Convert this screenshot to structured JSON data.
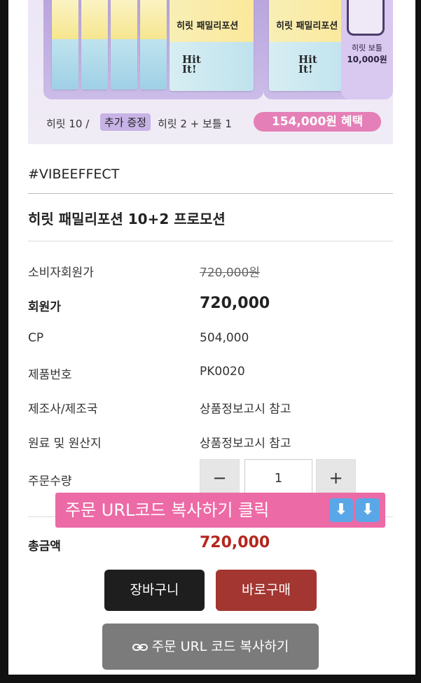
{
  "banner": {
    "product_name": "히릿 패밀리포션",
    "logo_text": "Hit It!",
    "bottle_title": "히릿 보틀",
    "bottle_price": "10,000원",
    "line_text_1": "히릿 10 /",
    "tag": "추가 증정",
    "line_text_2": "히릿 2 + 보틀 1",
    "benefit": "154,000원 혜택"
  },
  "hashtag": "#VIBEEFFECT",
  "product_title": "히릿 패밀리포션 10+2 프로모션",
  "info": {
    "consumer_price_label": "소비자회원가",
    "consumer_price": "720,000원",
    "member_price_label": "회원가",
    "member_price": "720,000",
    "cp_label": "CP",
    "cp_value": "504,000",
    "product_no_label": "제품번호",
    "product_no": "PK0020",
    "maker_label": "제조사/제조국",
    "maker_value": "상품정보고시 참고",
    "origin_label": "원료 및 원산지",
    "origin_value": "상품정보고시 참고",
    "qty_label": "주문수량"
  },
  "quantity": {
    "minus": "−",
    "value": "1",
    "plus": "+"
  },
  "promo_overlay": "주문 URL코드 복사하기 클릭",
  "promo_arrows": [
    "⬇",
    "⬇"
  ],
  "total_label": "총금액",
  "total_value": "720,000",
  "buttons": {
    "cart": "장바구니",
    "buy": "바로구매",
    "copy_url": "주문 URL 코드 복사하기"
  },
  "colors": {
    "buy": "#a33631",
    "total": "#b3261e",
    "promo": "#ec6aa5",
    "benefit_pill": "#e57fb7"
  }
}
